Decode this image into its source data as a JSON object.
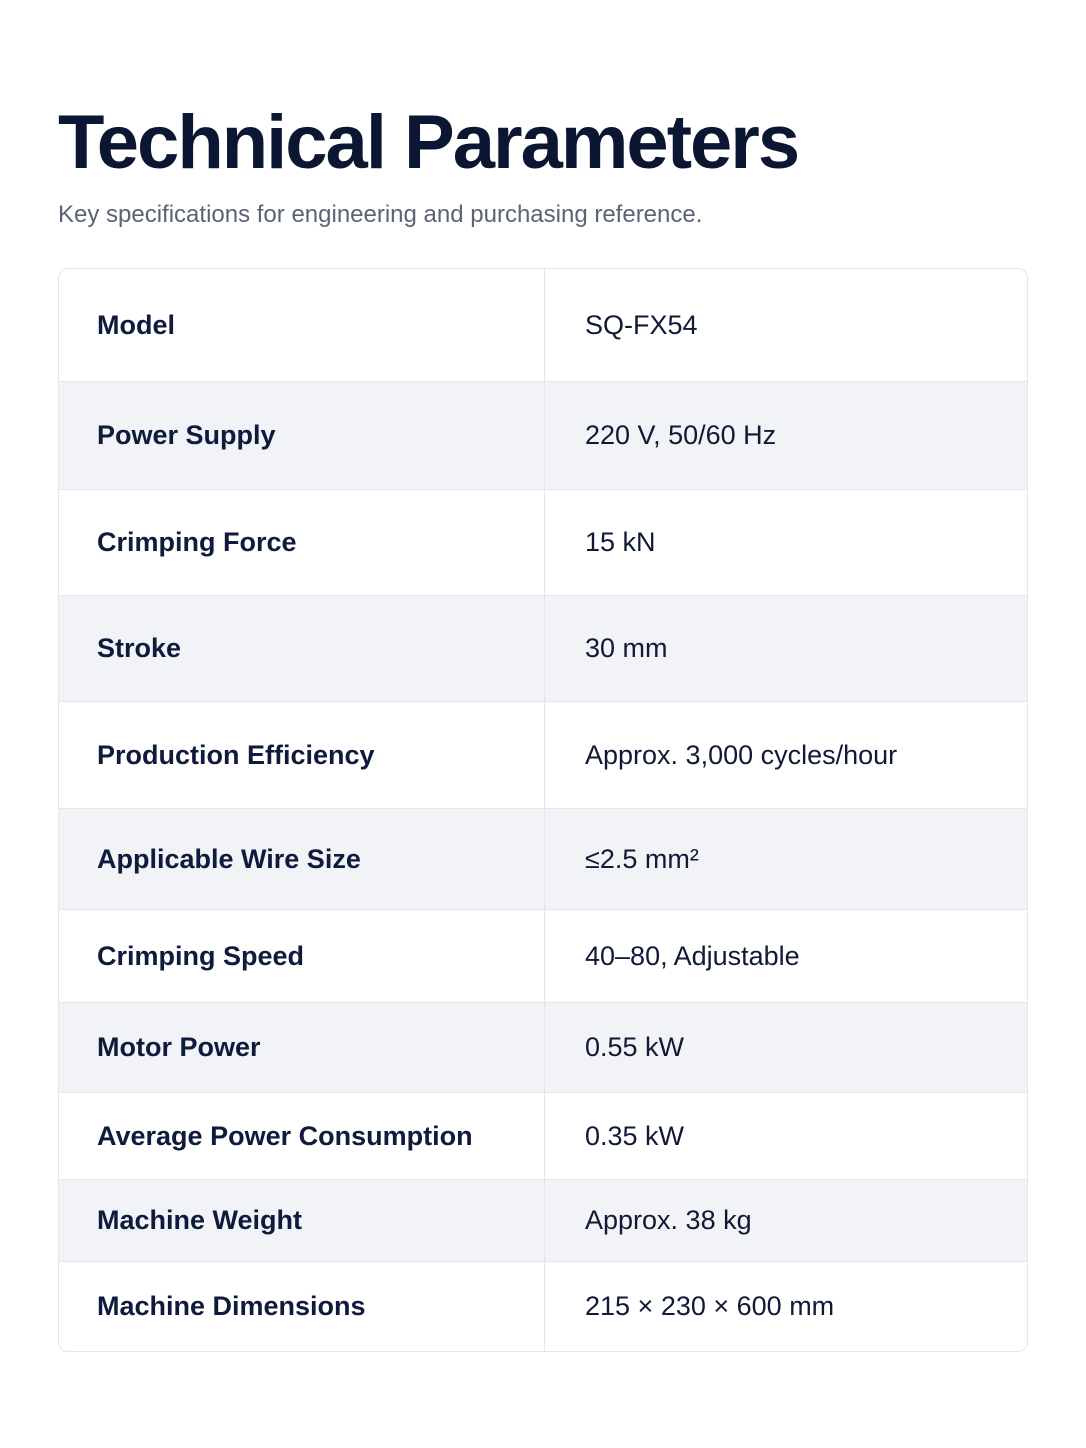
{
  "header": {
    "title": "Technical Parameters",
    "subtitle": "Key specifications for engineering and purchasing reference."
  },
  "specs": [
    {
      "label": "Model",
      "value": "SQ-FX54"
    },
    {
      "label": "Power Supply",
      "value": "220 V, 50/60 Hz"
    },
    {
      "label": "Crimping Force",
      "value": "15 kN"
    },
    {
      "label": "Stroke",
      "value": "30 mm"
    },
    {
      "label": "Production Efficiency",
      "value": "Approx. 3,000 cycles/hour"
    },
    {
      "label": "Applicable Wire Size",
      "value": "≤2.5 mm²"
    },
    {
      "label": "Crimping Speed",
      "value": "40–80, Adjustable"
    },
    {
      "label": "Motor Power",
      "value": "0.55 kW"
    },
    {
      "label": "Average Power Consumption",
      "value": "0.35 kW"
    },
    {
      "label": "Machine Weight",
      "value": "Approx. 38 kg"
    },
    {
      "label": "Machine Dimensions",
      "value": "215 × 230 × 600 mm"
    }
  ]
}
